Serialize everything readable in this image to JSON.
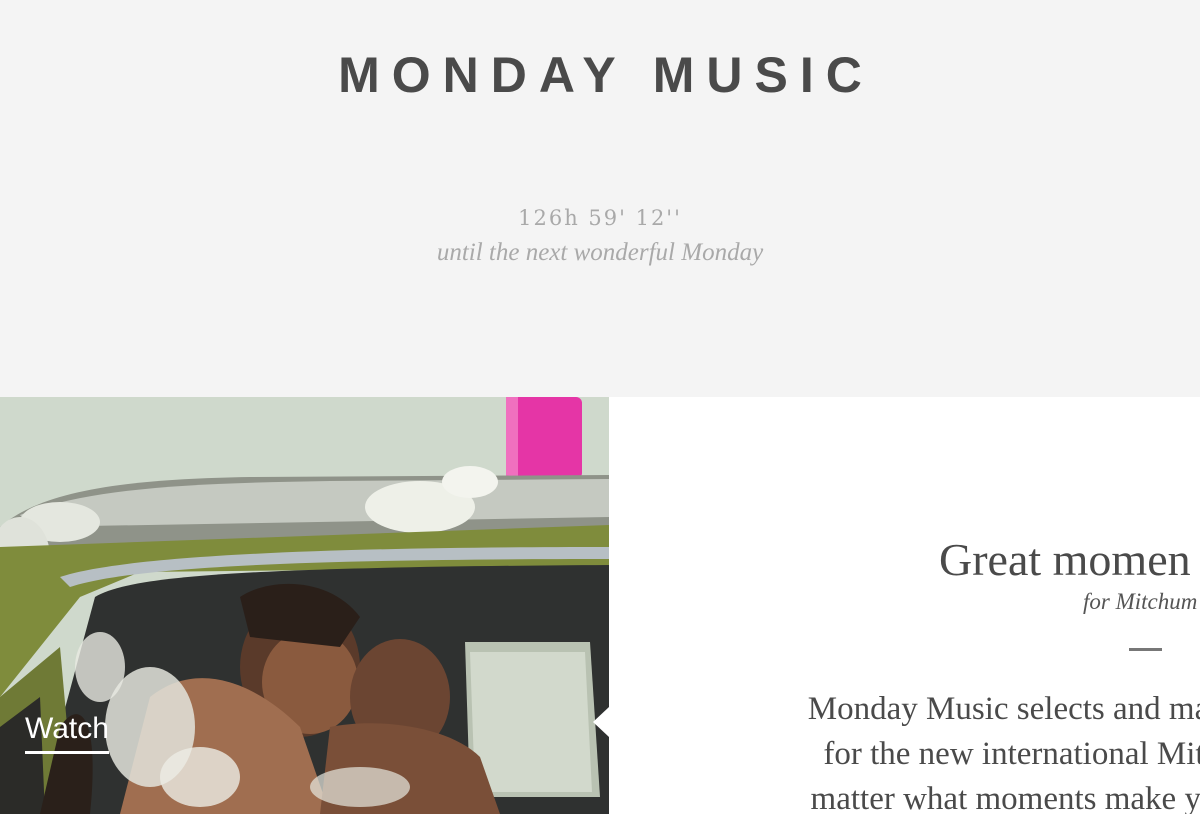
{
  "site": {
    "title": "MONDAY MUSIC"
  },
  "countdown": {
    "time": "126h 59' 12''",
    "caption": "until the next wonderful Monday"
  },
  "media": {
    "watch_label": "Watch"
  },
  "article": {
    "title": "Great momen",
    "subtitle": "for Mitchum",
    "body_lines": [
      "Monday Music selects and mar",
      "for the new international Mit",
      "matter what moments make yo"
    ]
  },
  "colors": {
    "background": "#f4f4f4",
    "title": "#4a4a4a",
    "countdown": "#a9a9a9",
    "panel": "#ffffff",
    "accent_pink": "#e535a6"
  }
}
